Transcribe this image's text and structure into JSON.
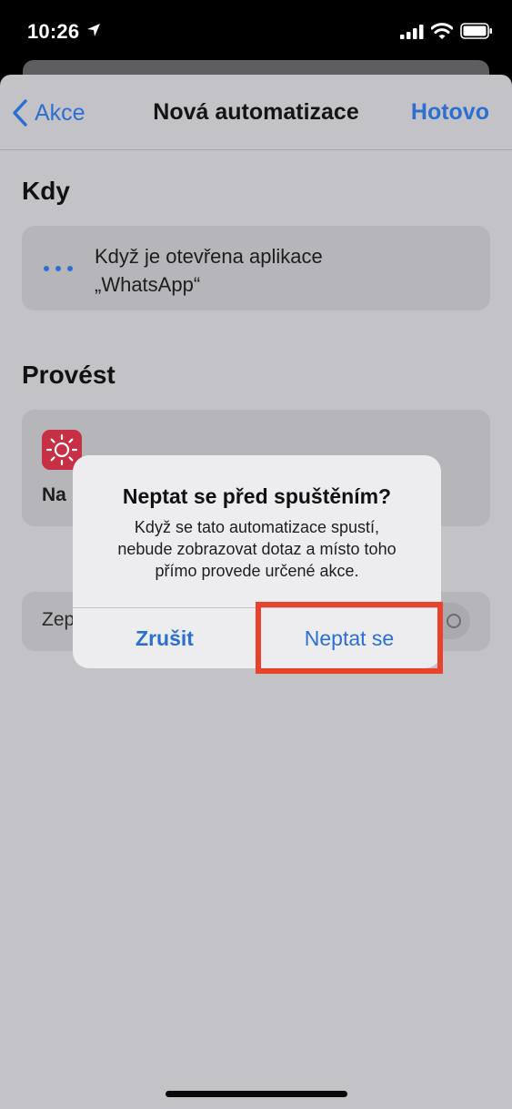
{
  "status_bar": {
    "time": "10:26"
  },
  "nav": {
    "back_label": "Akce",
    "title": "Nová automatizace",
    "done_label": "Hotovo"
  },
  "when": {
    "section_title": "Kdy",
    "trigger_line1": "Když je otevřena aplikace",
    "trigger_line2": "„WhatsApp“"
  },
  "do": {
    "section_title": "Provést",
    "action_label_partial": "Na",
    "action_icon": "sun-icon"
  },
  "ask_toggle": {
    "label_partial": "Zep",
    "value": "off"
  },
  "alert": {
    "title": "Neptat se před spuštěním?",
    "message_line1": "Když se tato automatizace spustí,",
    "message_line2": "nebude zobrazovat dotaz a místo toho",
    "message_line3": "přímo provede určené akce.",
    "cancel_label": "Zrušit",
    "confirm_label": "Neptat se"
  },
  "colors": {
    "accent": "#2d6fd0",
    "highlight": "#e8412c",
    "action_icon_bg": "#c72f45"
  }
}
